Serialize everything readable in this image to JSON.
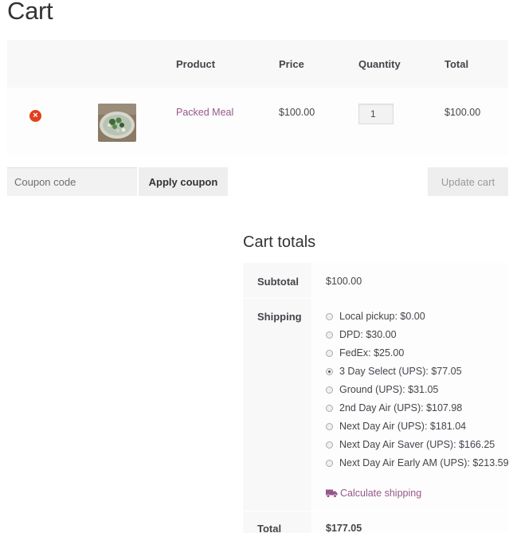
{
  "page": {
    "title": "Cart"
  },
  "cart": {
    "headers": {
      "product": "Product",
      "price": "Price",
      "quantity": "Quantity",
      "total": "Total"
    },
    "item": {
      "remove_glyph": "×",
      "product_name": "Packed Meal",
      "price": "$100.00",
      "quantity": "1",
      "total": "$100.00"
    }
  },
  "coupon": {
    "placeholder": "Coupon code",
    "apply_label": "Apply coupon",
    "update_label": "Update cart"
  },
  "totals": {
    "title": "Cart totals",
    "subtotal_label": "Subtotal",
    "subtotal_value": "$100.00",
    "shipping_label": "Shipping",
    "shipping_options": [
      {
        "label": "Local pickup: $0.00",
        "checked": false
      },
      {
        "label": "DPD: $30.00",
        "checked": false
      },
      {
        "label": "FedEx: $25.00",
        "checked": false
      },
      {
        "label": "3 Day Select (UPS): $77.05",
        "checked": true
      },
      {
        "label": "Ground (UPS): $31.05",
        "checked": false
      },
      {
        "label": "2nd Day Air (UPS): $107.98",
        "checked": false
      },
      {
        "label": "Next Day Air (UPS): $181.04",
        "checked": false
      },
      {
        "label": "Next Day Air Saver (UPS): $166.25",
        "checked": false
      },
      {
        "label": "Next Day Air Early AM (UPS): $213.59",
        "checked": false
      }
    ],
    "calculate_shipping_label": "Calculate shipping",
    "total_label": "Total",
    "total_value": "$177.05"
  },
  "colors": {
    "accent": "#96588a",
    "remove": "#e2401c",
    "header_bg": "#f8f8f8",
    "button_bg": "#eeeeee"
  },
  "icons": {
    "remove": "close-circle-icon",
    "shipping": "truck-icon"
  }
}
